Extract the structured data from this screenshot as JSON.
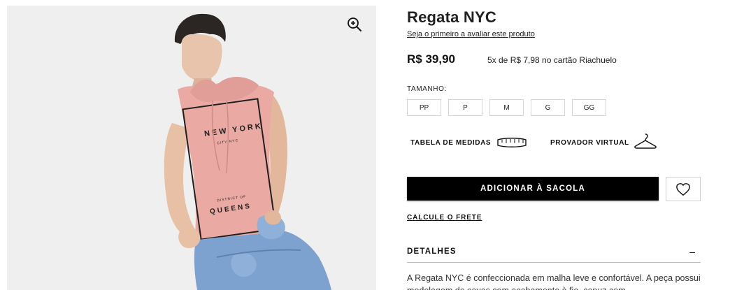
{
  "product": {
    "title": "Regata NYC",
    "review_link": "Seja o primeiro a avaliar este produto",
    "price": "R$ 39,90",
    "installments": "5x de R$ 7,98 no cartão Riachuelo"
  },
  "sizes": {
    "label": "TAMANHO:",
    "options": [
      "PP",
      "P",
      "M",
      "G",
      "GG"
    ]
  },
  "tools": {
    "size_chart": "TABELA DE MEDIDAS",
    "virtual_fitting": "PROVADOR VIRTUAL"
  },
  "actions": {
    "add_to_bag": "ADICIONAR À SACOLA",
    "calc_freight": "CALCULE O FRETE"
  },
  "details": {
    "title": "DETALHES",
    "toggle": "–",
    "text": "A Regata NYC é confeccionada em malha leve e confortável. A peça possui modelagem de cavas com acabamento à fio, capuz com"
  },
  "shirt_print": {
    "line1": "NEW YORK",
    "line2": "CITY NYC",
    "line3": "DISTRICT OF",
    "line4": "QUEENS"
  },
  "icons": {
    "zoom": "zoom-in-icon",
    "tape": "measuring-tape-icon",
    "hanger": "hanger-icon",
    "heart": "heart-icon"
  },
  "colors": {
    "primary_button": "#000000",
    "shirt": "#eaa9a3",
    "denim": "#7ea2cf",
    "background_image": "#efefef"
  }
}
